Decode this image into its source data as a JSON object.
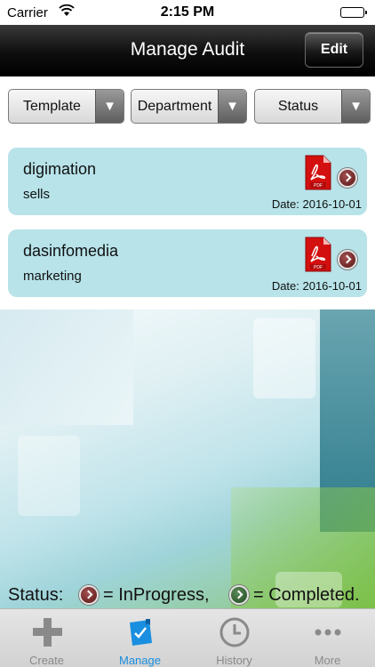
{
  "status_bar": {
    "carrier": "Carrier",
    "time": "2:15 PM"
  },
  "nav": {
    "title": "Manage Audit",
    "edit_label": "Edit"
  },
  "filters": [
    {
      "label": "Template"
    },
    {
      "label": "Department"
    },
    {
      "label": "Status"
    }
  ],
  "audits": [
    {
      "name": "digimation",
      "department": "sells",
      "date": "Date: 2016-10-01",
      "status": "InProgress"
    },
    {
      "name": "dasinfomedia",
      "department": "marketing",
      "date": "Date: 2016-10-01",
      "status": "InProgress"
    }
  ],
  "legend": {
    "status_label": "Status:",
    "inprogress_text": "= InProgress,",
    "completed_text": "= Completed."
  },
  "tabs": [
    {
      "label": "Create",
      "icon": "plus-icon"
    },
    {
      "label": "Manage",
      "icon": "manage-icon",
      "active": true
    },
    {
      "label": "History",
      "icon": "clock-icon"
    },
    {
      "label": "More",
      "icon": "more-dots-icon"
    }
  ],
  "colors": {
    "card_bg": "#b7e3e9",
    "active_tab": "#1a8fe0",
    "inprogress": "#7a2a2a",
    "completed": "#2f5f2f"
  }
}
